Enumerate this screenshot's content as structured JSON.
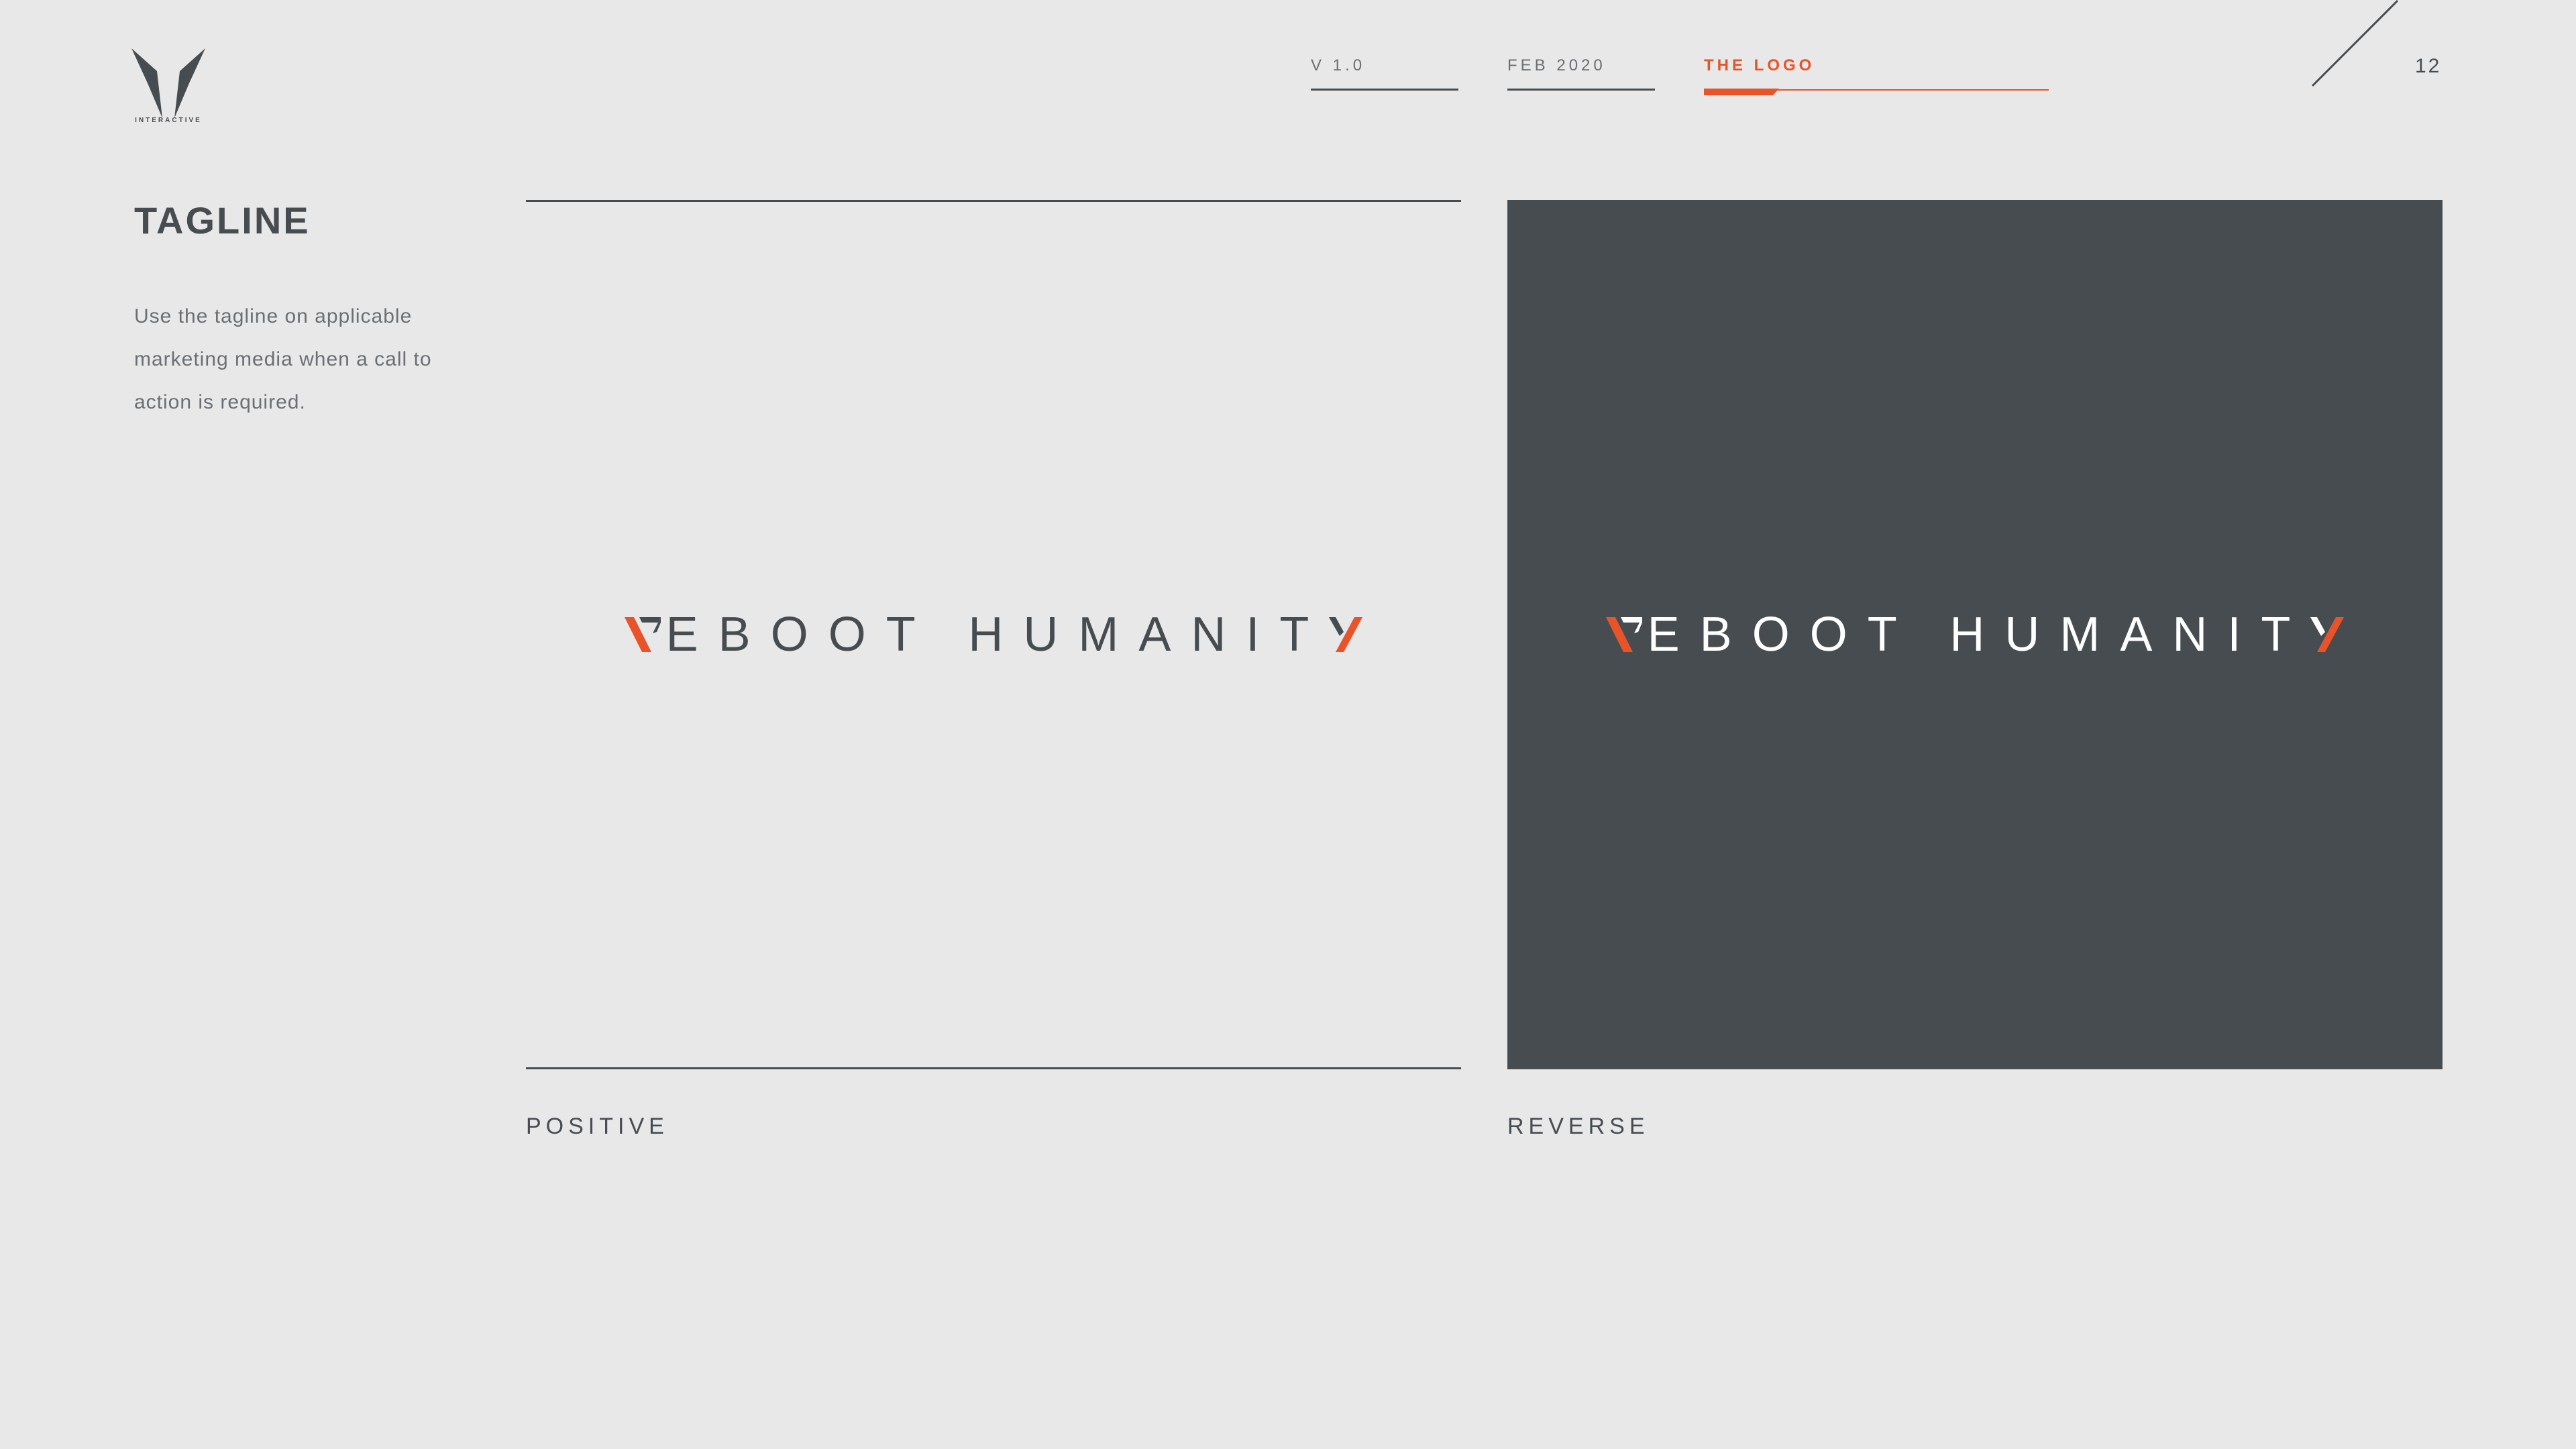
{
  "brand": {
    "logo_text": "INTERACTIVE"
  },
  "nav": {
    "items": [
      {
        "label": "V 1.0",
        "active": false
      },
      {
        "label": "FEB 2020",
        "active": false
      },
      {
        "label": "THE LOGO",
        "active": true
      }
    ],
    "page_number": "12"
  },
  "section": {
    "title": "TAGLINE",
    "description": "Use the tagline on applicable marketing media when a call to action is required."
  },
  "panels": {
    "positive": {
      "tagline_middle": "EBOOT HUMANIT",
      "caption": "POSITIVE"
    },
    "reverse": {
      "tagline_middle": "EBOOT HUMANIT",
      "caption": "REVERSE"
    }
  },
  "colors": {
    "background": "#e8e8e8",
    "dark": "#474c51",
    "accent": "#e8532a",
    "text_light": "#ffffff"
  }
}
